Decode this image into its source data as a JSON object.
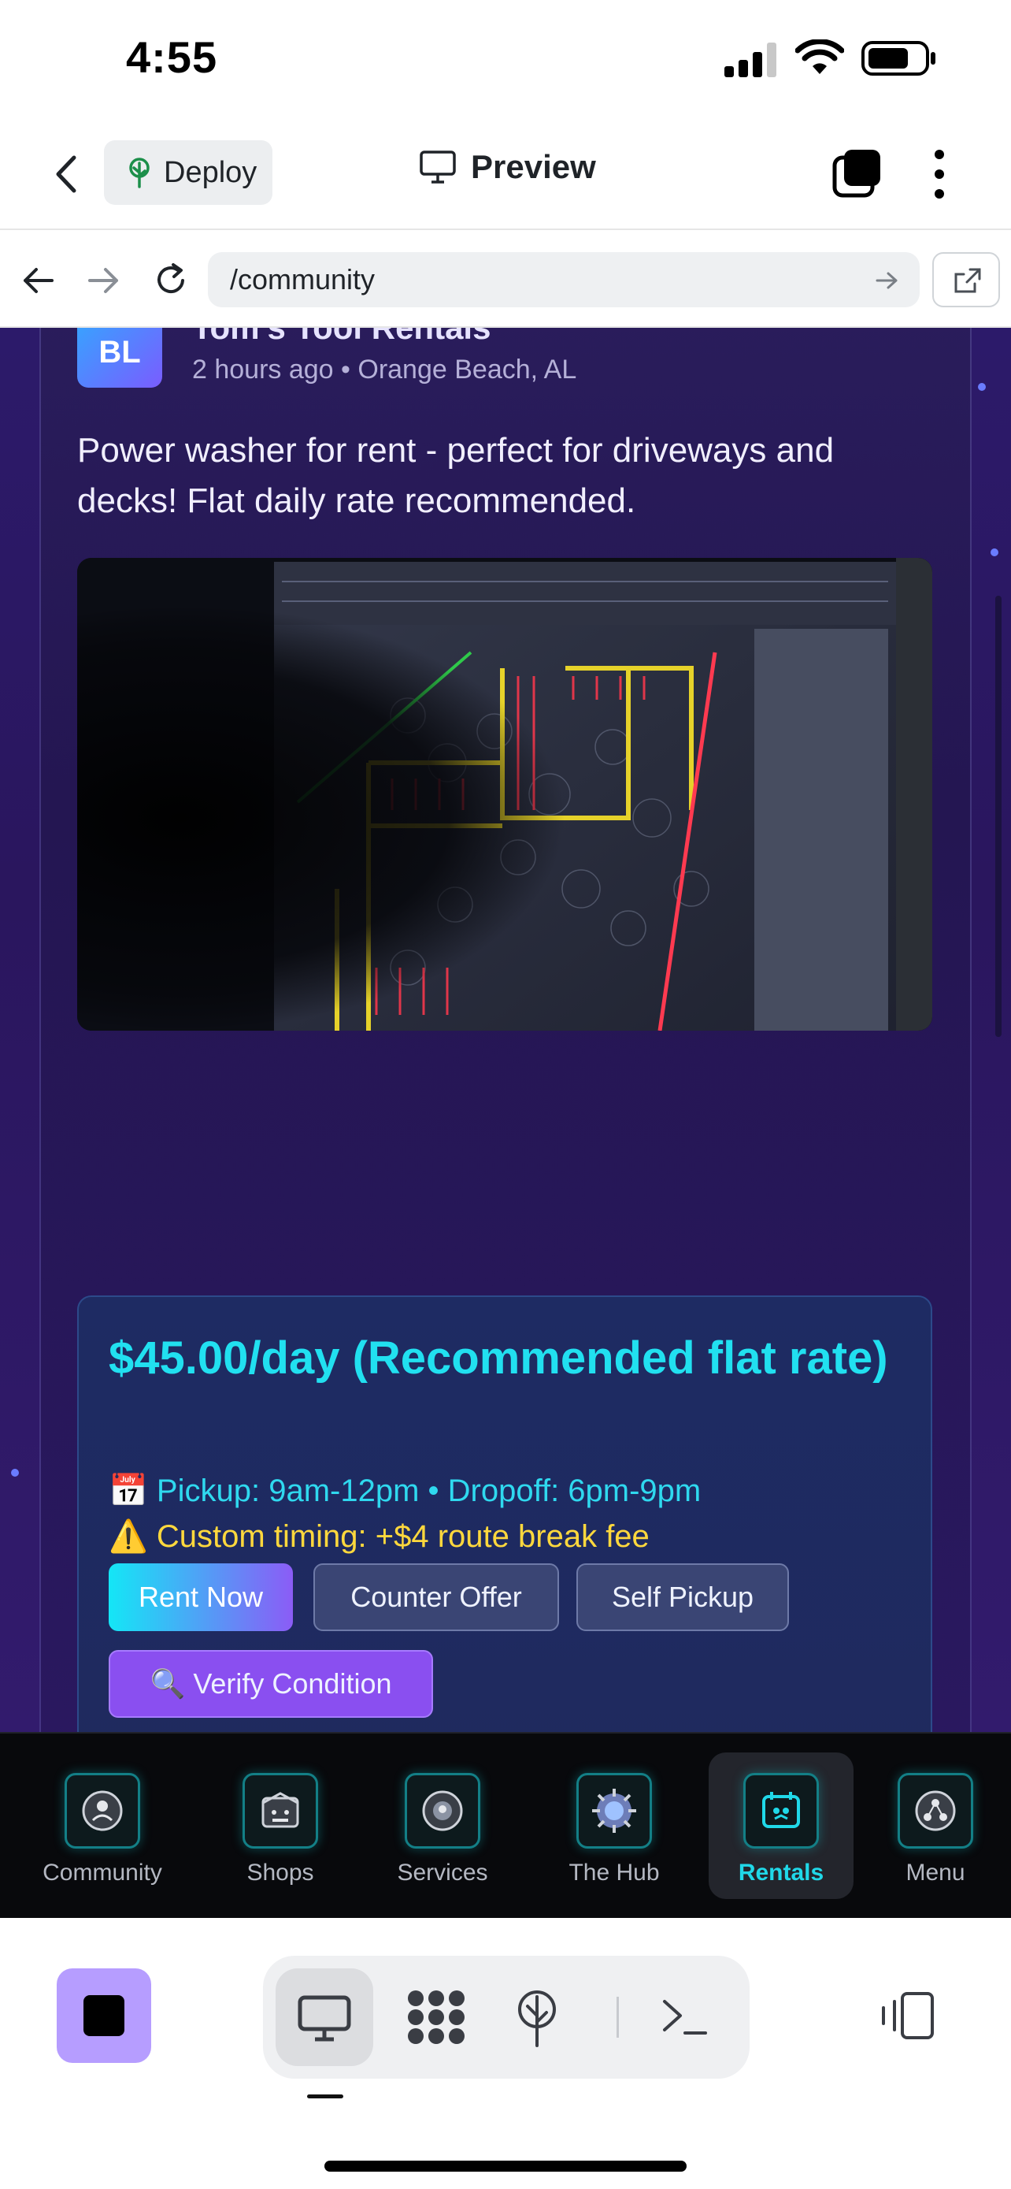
{
  "status_bar": {
    "time": "4:55"
  },
  "app_bar": {
    "deploy_label": "Deploy",
    "title": "Preview"
  },
  "browser": {
    "url": "/community"
  },
  "post": {
    "avatar_initials": "BL",
    "author": "Tom's Tool Rentals",
    "meta": "2 hours ago • Orange Beach, AL",
    "text": "Power washer for rent - perfect for driveways and decks! Flat daily rate recommended.",
    "price_title": "$45.00/day (Recommended flat rate)",
    "schedule": "📅 Pickup: 9am-12pm • Dropoff: 6pm-9pm",
    "custom_fee": "⚠️ Custom timing: +$4 route break fee",
    "buttons": {
      "rent_now": "Rent Now",
      "counter_offer": "Counter Offer",
      "self_pickup": "Self Pickup",
      "verify_condition": "🔍 Verify Condition"
    }
  },
  "tabbar": {
    "items": [
      {
        "label": "Community",
        "icon": "community-icon"
      },
      {
        "label": "Shops",
        "icon": "shop-icon"
      },
      {
        "label": "Services",
        "icon": "services-icon"
      },
      {
        "label": "The Hub",
        "icon": "hub-icon"
      },
      {
        "label": "Rentals",
        "icon": "rentals-icon",
        "active": true
      },
      {
        "label": "Menu",
        "icon": "menu-icon"
      }
    ]
  },
  "colors": {
    "accent_cyan": "#21e0f0",
    "warning_yellow": "#ffd83d",
    "verify_purple": "#8a4ff0",
    "stop_button": "#b69dff"
  }
}
